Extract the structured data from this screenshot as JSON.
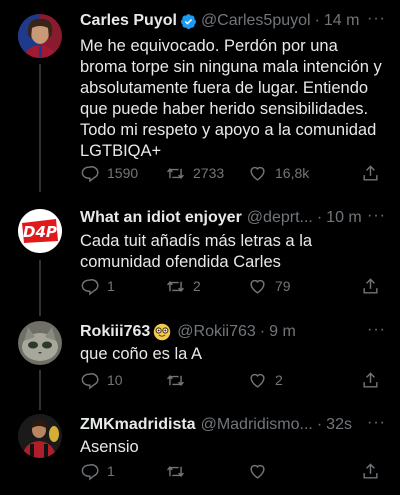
{
  "tweets": [
    {
      "name": "Carles Puyol",
      "handle": "@Carles5puyol",
      "time": "14 m",
      "verified": true,
      "text": "Me he equivocado. Perdón por una broma torpe sin ninguna mala intención y absolutamente fuera de lugar. Entiendo que puede haber herido sensibilidades. Todo mi respeto y apoyo a la comunidad LGTBIQA+",
      "replies": "1590",
      "retweets": "2733",
      "likes": "16,8k"
    },
    {
      "name": "What an idiot enjoyer",
      "handle": "@deprt...",
      "time": "10 m",
      "avatar_text": "D4P",
      "text": "Cada tuit añadís más letras a la comunidad ofendida Carles",
      "replies": "1",
      "retweets": "2",
      "likes": "79"
    },
    {
      "name": "Rokiii763",
      "handle": "@Rokii763",
      "time": "9 m",
      "text": "que coño es la A",
      "replies": "10",
      "retweets": "",
      "likes": "2"
    },
    {
      "name": "ZMKmadridista",
      "handle": "@Madridismo...",
      "time": "32s",
      "text": "Asensio",
      "replies": "1",
      "retweets": "",
      "likes": ""
    }
  ],
  "separator": "·",
  "more_glyph": "···",
  "colors": {
    "background": "#000000",
    "text": "#e7e9ea",
    "muted": "#71767b",
    "verified": "#1d9bf0",
    "d4p_red": "#e0191b"
  }
}
